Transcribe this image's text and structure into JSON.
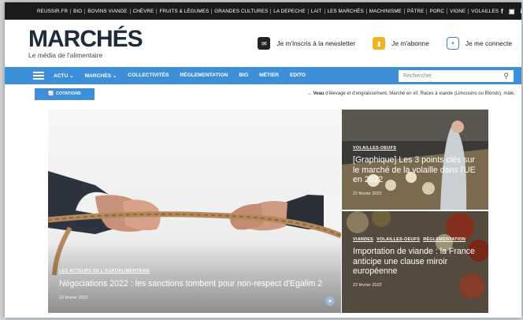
{
  "topbar": {
    "links": [
      "REUSSIR.FR",
      "BIO",
      "BOVINS VIANDE",
      "CHÈVRE",
      "FRUITS & LÉGUMES",
      "GRANDES CULTURES",
      "LA DEPECHE",
      "LAIT",
      "LES MARCHÉS",
      "MACHINISME",
      "PÂTRE",
      "PORC",
      "VIGNE",
      "VOLAILLES"
    ],
    "social": [
      "f",
      "▣",
      "in"
    ]
  },
  "header": {
    "logo": "MARCHÉS",
    "logo_prefix": "les",
    "tagline": "Le média de l'alimentaire",
    "newsletter": "Je m'inscris à la newsletter",
    "subscribe": "Je m'abonne",
    "login": "Je me connecte"
  },
  "nav": {
    "items": [
      "ACTU ⌄",
      "MARCHÉS ⌄",
      "COLLECTIVITÉS",
      "RÉGLEMENTATION",
      "BIO",
      "MÉTIER",
      "EDITO"
    ],
    "search_placeholder": "Rechercher"
  },
  "subbar": {
    "cotations": "COTATIONS",
    "ticker_bold": "Veau",
    "ticker_text": " d'élevage et d'engraissement, Marché en vif, Races à viande (Limousins ou Blonds), mâle,"
  },
  "hero": {
    "category": "LES ACTEURS DE L'AGROALIMENTAIRE",
    "title": "Négociations 2022 : les sanctions tombent pour non-respect d'Egalim 2",
    "date": "22 février 2022"
  },
  "side1": {
    "category": "VOLAILLES-OEUFS",
    "title": "[Graphique] Les 3 points clés sur le marché de la volaille dans l'UE en 2022",
    "date": "22 février 2022"
  },
  "side2": {
    "categories": [
      "VIANDES",
      "VOLAILLES-OEUFS",
      "RÉGLEMENTATION"
    ],
    "title": "Importation de viande : la France anticipe une clause miroir européenne",
    "date": "22 février 2022"
  },
  "colors": {
    "accent": "#3d8fd8",
    "topbar": "#1b1b1b",
    "logo": "#1e2b3a"
  }
}
